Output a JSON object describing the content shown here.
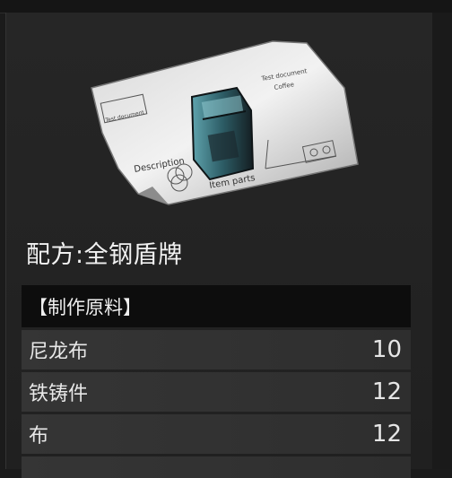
{
  "recipe": {
    "title": "配方:全钢盾牌",
    "image_icon": "blueprint-icon",
    "blueprint_labels": {
      "description": "Description",
      "item_parts": "Item parts",
      "top_right_1": "Test document",
      "top_right_2": "Coffee",
      "top_left": "Test document"
    }
  },
  "materials": {
    "header": "【制作原料】",
    "items": [
      {
        "name": "尼龙布",
        "qty": "10"
      },
      {
        "name": "铁铸件",
        "qty": "12"
      },
      {
        "name": "布",
        "qty": "12"
      }
    ]
  }
}
